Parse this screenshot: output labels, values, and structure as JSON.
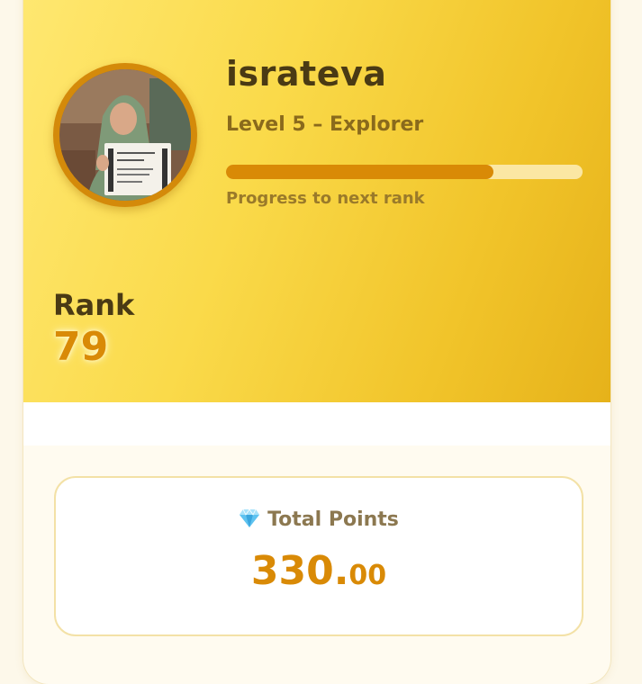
{
  "profile": {
    "username": "israteva",
    "level_text": "Level 5 – Explorer",
    "progress_label": "Progress to next rank",
    "progress_fraction": 0.75
  },
  "rank": {
    "label": "Rank",
    "value": "79"
  },
  "points": {
    "title": "Total Points",
    "integer_part": "330.",
    "decimal_part": "00",
    "icon": "gem-icon"
  },
  "colors": {
    "accent": "#d98a06",
    "hero_start": "#ffe872",
    "hero_end": "#e6b21a",
    "text_dark": "#4a3a14"
  }
}
